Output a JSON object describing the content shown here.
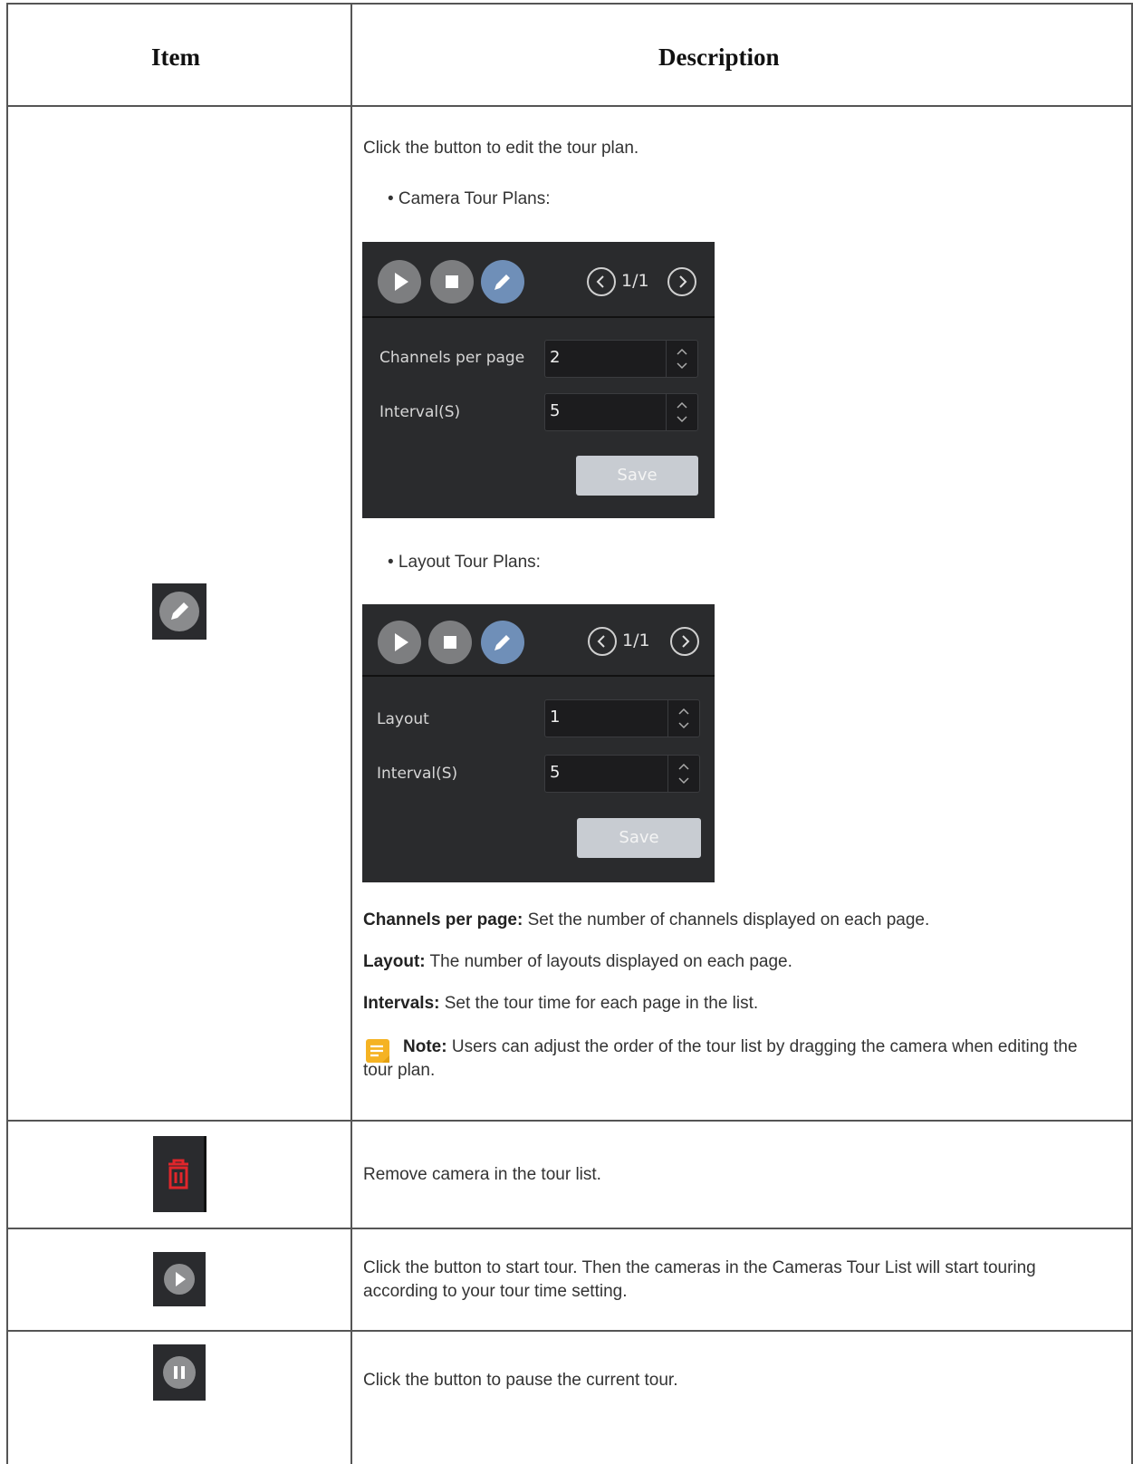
{
  "table": {
    "headers": {
      "item": "Item",
      "description": "Description"
    },
    "rows": [
      {
        "icon": "edit-pencil-icon",
        "intro": "Click the button to edit the tour plan.",
        "camera_heading": "• Camera Tour Plans:",
        "camera_panel": {
          "page": "1/1",
          "fields": [
            {
              "label": "Channels per page",
              "value": "2"
            },
            {
              "label": "Interval(S)",
              "value": "5"
            }
          ],
          "save": "Save"
        },
        "layout_heading": "• Layout Tour Plans:",
        "layout_panel": {
          "page": "1/1",
          "fields": [
            {
              "label": "Layout",
              "value": "1"
            },
            {
              "label": "Interval(S)",
              "value": "5"
            }
          ],
          "save": "Save"
        },
        "defs": [
          {
            "term": "Channels per page:",
            "text": " Set the number of channels displayed on each page."
          },
          {
            "term": "Layout:",
            "text": " The number of layouts displayed on each page."
          },
          {
            "term": "Intervals:",
            "text": " Set the tour time for each page in the list."
          }
        ],
        "note_label": "Note:",
        "note_text": "  Users can adjust the order of the tour list by dragging the camera when editing the tour plan."
      },
      {
        "icon": "trash-icon",
        "text": "Remove camera in the tour list."
      },
      {
        "icon": "play-icon",
        "text": "Click the button to start tour. Then the cameras in the Cameras Tour List will start touring according to your tour time setting."
      },
      {
        "icon": "pause-icon",
        "text": "Click the button to pause the current tour."
      }
    ]
  }
}
